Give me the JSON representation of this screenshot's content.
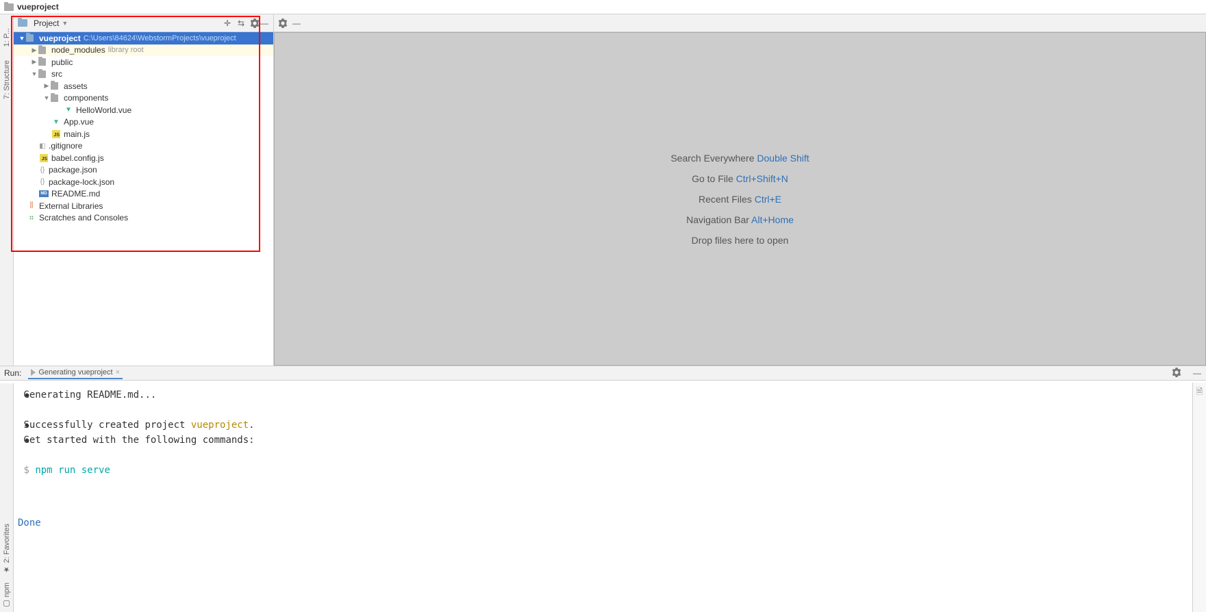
{
  "topbar": {
    "project_name": "vueproject"
  },
  "sidebar_left": {
    "structure": "7: Structure",
    "other": "1: P..."
  },
  "project_panel": {
    "title": "Project",
    "root": {
      "name": "vueproject",
      "path": "C:\\Users\\84624\\WebstormProjects\\vueproject"
    },
    "nodes": {
      "node_modules": "node_modules",
      "library_root": "library root",
      "public": "public",
      "src": "src",
      "assets": "assets",
      "components": "components",
      "hello": "HelloWorld.vue",
      "app": "App.vue",
      "main": "main.js",
      "gitignore": ".gitignore",
      "babel": "babel.config.js",
      "package": "package.json",
      "lock": "package-lock.json",
      "readme": "README.md",
      "ext_lib": "External Libraries",
      "scratches": "Scratches and Consoles"
    }
  },
  "editor_hints": {
    "search": {
      "label": "Search Everywhere",
      "key": "Double Shift"
    },
    "goto": {
      "label": "Go to File",
      "key": "Ctrl+Shift+N"
    },
    "recent": {
      "label": "Recent Files",
      "key": "Ctrl+E"
    },
    "nav": {
      "label": "Navigation Bar",
      "key": "Alt+Home"
    },
    "drop": "Drop files here to open"
  },
  "run": {
    "label": "Run:",
    "tab": "Generating vueproject"
  },
  "console": {
    "l1": "Generating README.md...",
    "l2a": "Successfully created project ",
    "l2b": "vueproject",
    "l2c": ".",
    "l3": "Get started with the following commands:",
    "l4_prompt": "$",
    "l4_cmd": "npm run serve",
    "done": "Done"
  },
  "bottom_rail": {
    "fav": "2: Favorites",
    "npm": "npm"
  }
}
